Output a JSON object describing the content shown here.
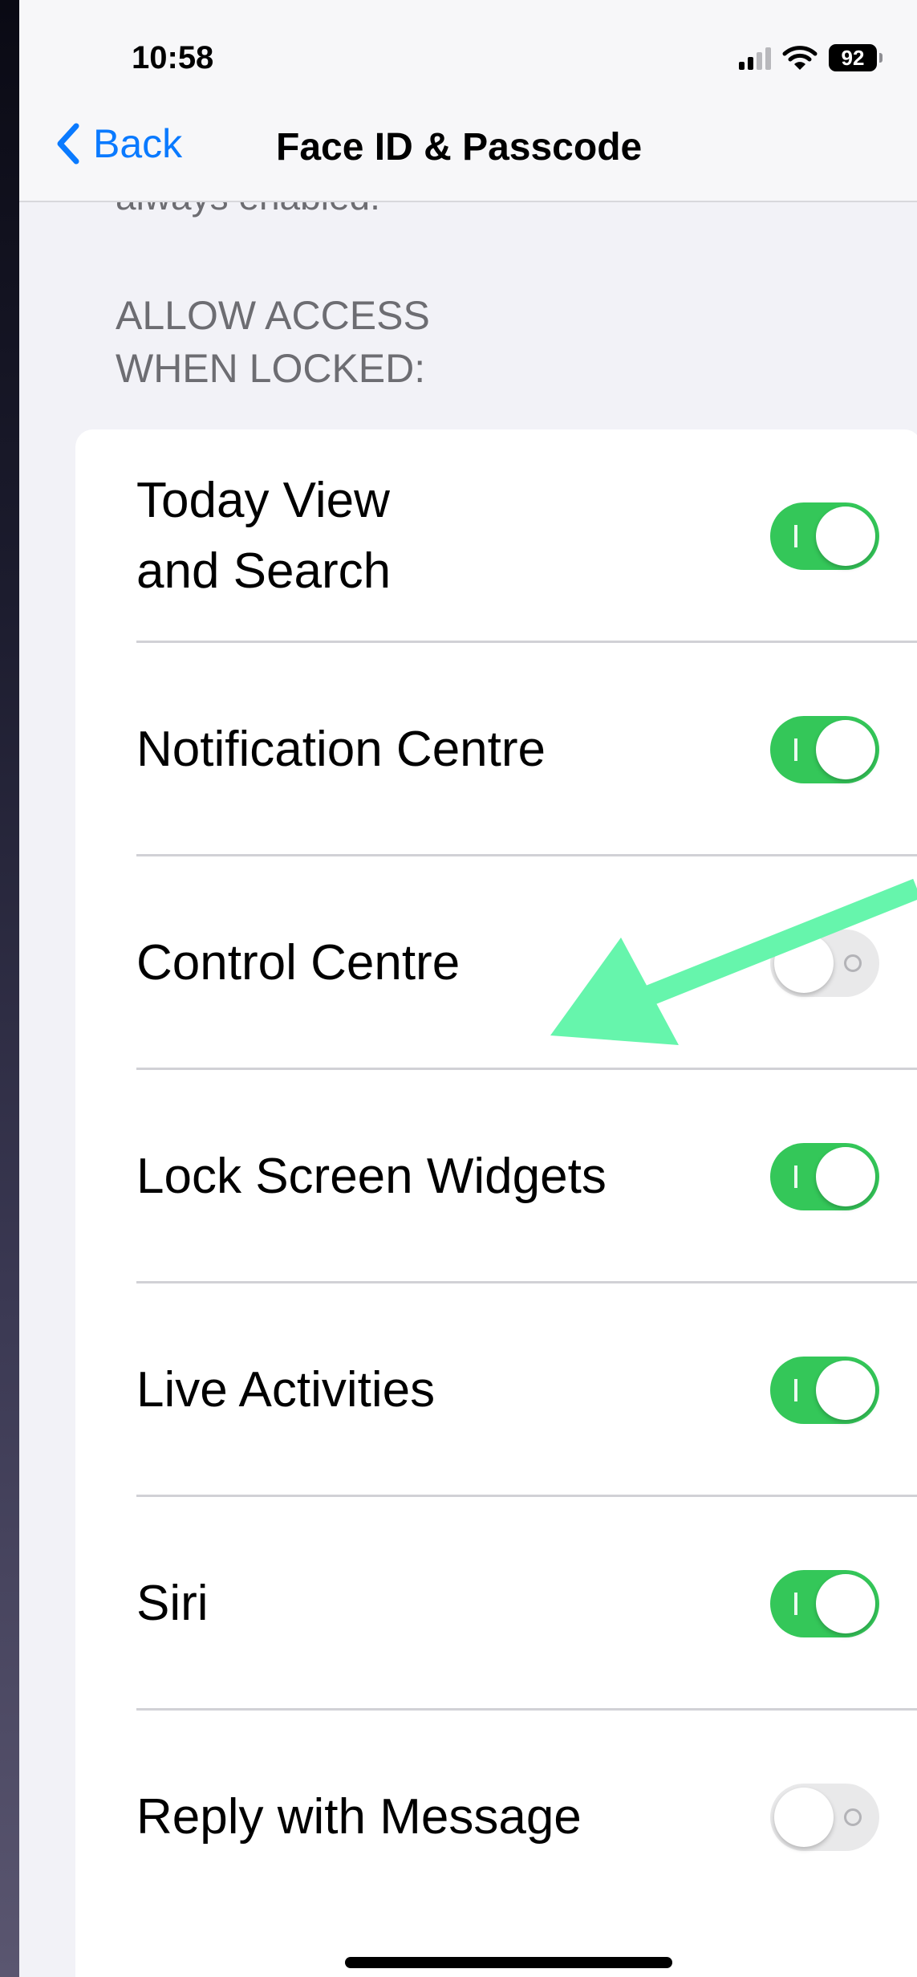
{
  "status_bar": {
    "time": "10:58",
    "battery": "92"
  },
  "nav": {
    "back_label": "Back",
    "title": "Face ID & Passcode"
  },
  "previous_footer_fragment": "always enabled.",
  "section": {
    "header_line1": "ALLOW ACCESS",
    "header_line2": "WHEN LOCKED:"
  },
  "rows": [
    {
      "label_line1": "Today View",
      "label_line2": "and Search",
      "enabled": true
    },
    {
      "label": "Notification Centre",
      "enabled": true
    },
    {
      "label": "Control Centre",
      "enabled": false
    },
    {
      "label": "Lock Screen Widgets",
      "enabled": true
    },
    {
      "label": "Live Activities",
      "enabled": true
    },
    {
      "label": "Siri",
      "enabled": true
    },
    {
      "label": "Reply with Message",
      "enabled": false
    }
  ],
  "annotation": {
    "type": "arrow",
    "points_to": "Control Centre",
    "color": "#66f5ac"
  },
  "colors": {
    "toggle_on": "#34c759",
    "toggle_off": "#e9e9ea",
    "link_blue": "#0a7aff",
    "background": "#f2f2f7"
  }
}
